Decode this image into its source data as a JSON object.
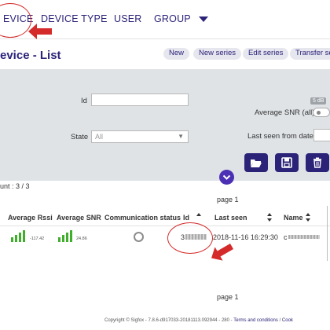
{
  "nav": {
    "items": [
      "EVICE",
      "DEVICE TYPE",
      "USER",
      "GROUP"
    ]
  },
  "page": {
    "title": "evice - List",
    "actions": [
      "New",
      "New series",
      "Edit series",
      "Transfer se"
    ]
  },
  "filters": {
    "id_label": "Id",
    "id_value": "",
    "state_label": "State",
    "state_value": "All",
    "snr_label": "Average SNR (all)",
    "snr_badge": "5 dB",
    "last_seen_label": "Last seen from date"
  },
  "actions_icons": [
    "folder-open-icon",
    "save-icon",
    "trash-icon"
  ],
  "results": {
    "count": "unt : 3 / 3",
    "page_top": "page 1",
    "page_bottom": "page 1"
  },
  "table": {
    "columns": [
      "Average Rssi",
      "Average SNR",
      "Communication status",
      "Id",
      "Last seen",
      "Name"
    ],
    "rows": [
      {
        "rssi": "-117.42",
        "snr": "24.86",
        "id": "3",
        "last_seen": "2018-11-16 16:29:30",
        "name": "c"
      }
    ]
  },
  "footer": {
    "text": "Copyright © Sigfox - 7.8.6-d917033-20181113.092944 - 280 - ",
    "terms": "Terms and conditions",
    "cookies": "Cook"
  },
  "colors": {
    "brand": "#2b2378",
    "annotation": "#d42a2a",
    "signal": "#3fae2a"
  }
}
